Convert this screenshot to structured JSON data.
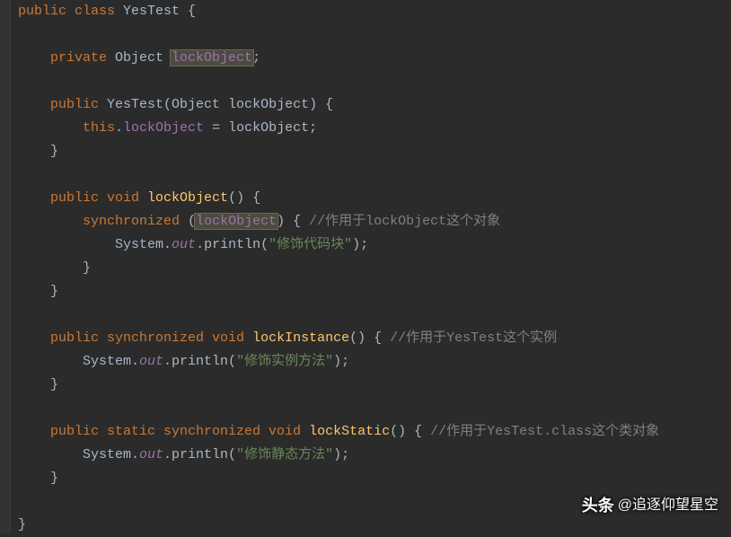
{
  "code": {
    "l1": {
      "kw1": "public class ",
      "cls": "YesTest",
      "t": " {"
    },
    "l3": {
      "kw1": "private ",
      "type": "Object ",
      "field": "lockObject",
      "t": ";"
    },
    "l5": {
      "kw1": "public ",
      "ctor": "YesTest",
      "t1": "(Object lockObject) {"
    },
    "l6": {
      "kw1": "this",
      "t1": ".",
      "field": "lockObject",
      "t2": " = lockObject;"
    },
    "l7": {
      "t": "}"
    },
    "l9": {
      "kw1": "public void ",
      "method": "lockObject",
      "t": "() {"
    },
    "l10": {
      "kw1": "synchronized ",
      "t1": "(",
      "field": "lockObject",
      "t2": ") { ",
      "comment": "//作用于lockObject这个对象"
    },
    "l11": {
      "t1": "System.",
      "field": "out",
      "t2": ".println(",
      "str": "\"修饰代码块\"",
      "t3": ");"
    },
    "l12": {
      "t": "}"
    },
    "l13": {
      "t": "}"
    },
    "l15": {
      "kw1": "public synchronized void ",
      "method": "lockInstance",
      "t": "() { ",
      "comment": "//作用于YesTest这个实例"
    },
    "l16": {
      "t1": "System.",
      "field": "out",
      "t2": ".println(",
      "str": "\"修饰实例方法\"",
      "t3": ");"
    },
    "l17": {
      "t": "}"
    },
    "l19": {
      "kw1": "public static synchronized void ",
      "method": "lockStatic",
      "t": "() { ",
      "comment": "//作用于YesTest.class这个类对象"
    },
    "l20": {
      "t1": "System.",
      "field": "out",
      "t2": ".println(",
      "str": "\"修饰静态方法\"",
      "t3": ");"
    },
    "l21": {
      "t": "}"
    },
    "l23": {
      "t": "}"
    }
  },
  "watermark": {
    "brand": "头条",
    "user": "@追逐仰望星空"
  }
}
